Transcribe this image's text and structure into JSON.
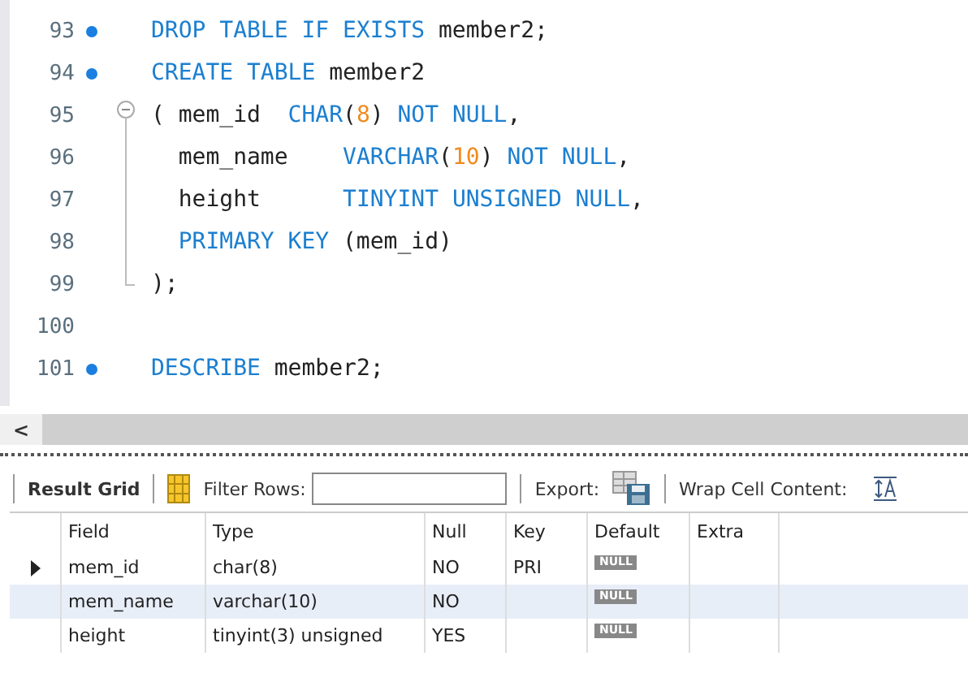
{
  "editor": {
    "lines": [
      {
        "number": "93",
        "statement": true,
        "fold_start": false,
        "fold_body": false,
        "fold_end": false,
        "tokens": [
          {
            "text": "DROP TABLE IF EXISTS",
            "kind": "keyword"
          },
          {
            "text": " member2;",
            "kind": "plain"
          }
        ]
      },
      {
        "number": "94",
        "statement": true,
        "fold_start": false,
        "fold_body": false,
        "fold_end": false,
        "tokens": [
          {
            "text": "CREATE TABLE",
            "kind": "keyword"
          },
          {
            "text": " member2",
            "kind": "plain"
          }
        ]
      },
      {
        "number": "95",
        "statement": false,
        "fold_start": true,
        "fold_body": false,
        "fold_end": false,
        "tokens": [
          {
            "text": "( mem_id  ",
            "kind": "plain"
          },
          {
            "text": "CHAR",
            "kind": "keyword"
          },
          {
            "text": "(",
            "kind": "plain"
          },
          {
            "text": "8",
            "kind": "number"
          },
          {
            "text": ") ",
            "kind": "plain"
          },
          {
            "text": "NOT NULL",
            "kind": "keyword"
          },
          {
            "text": ",",
            "kind": "plain"
          }
        ]
      },
      {
        "number": "96",
        "statement": false,
        "fold_start": false,
        "fold_body": true,
        "fold_end": false,
        "tokens": [
          {
            "text": "  mem_name    ",
            "kind": "plain"
          },
          {
            "text": "VARCHAR",
            "kind": "keyword"
          },
          {
            "text": "(",
            "kind": "plain"
          },
          {
            "text": "10",
            "kind": "number"
          },
          {
            "text": ") ",
            "kind": "plain"
          },
          {
            "text": "NOT NULL",
            "kind": "keyword"
          },
          {
            "text": ",",
            "kind": "plain"
          }
        ]
      },
      {
        "number": "97",
        "statement": false,
        "fold_start": false,
        "fold_body": true,
        "fold_end": false,
        "tokens": [
          {
            "text": "  height      ",
            "kind": "plain"
          },
          {
            "text": "TINYINT UNSIGNED NULL",
            "kind": "keyword"
          },
          {
            "text": ",",
            "kind": "plain"
          }
        ]
      },
      {
        "number": "98",
        "statement": false,
        "fold_start": false,
        "fold_body": true,
        "fold_end": false,
        "tokens": [
          {
            "text": "  PRIMARY KEY",
            "kind": "keyword"
          },
          {
            "text": " (mem_id)",
            "kind": "plain"
          }
        ]
      },
      {
        "number": "99",
        "statement": false,
        "fold_start": false,
        "fold_body": false,
        "fold_end": true,
        "tokens": [
          {
            "text": ");",
            "kind": "plain"
          }
        ]
      },
      {
        "number": "100",
        "statement": false,
        "fold_start": false,
        "fold_body": false,
        "fold_end": false
      },
      {
        "number": "101",
        "statement": true,
        "fold_start": false,
        "fold_body": false,
        "fold_end": false,
        "tokens": [
          {
            "text": "DESCRIBE",
            "kind": "keyword"
          },
          {
            "text": " member2;",
            "kind": "plain"
          }
        ]
      }
    ]
  },
  "scrollbar": {
    "arrow": "<"
  },
  "toolbar": {
    "result_grid": "Result Grid",
    "filter_label": "Filter Rows:",
    "export_label": "Export:",
    "wrap_label": "Wrap Cell Content:"
  },
  "grid": {
    "columns": [
      "Field",
      "Type",
      "Null",
      "Key",
      "Default",
      "Extra"
    ],
    "rows": [
      {
        "current": true,
        "cells": [
          "mem_id",
          "char(8)",
          "NO",
          "PRI",
          "NULL",
          null
        ]
      },
      {
        "current": false,
        "cells": [
          "mem_name",
          "varchar(10)",
          "NO",
          null,
          "NULL",
          null
        ]
      },
      {
        "current": false,
        "cells": [
          "height",
          "tinyint(3) unsigned",
          "YES",
          null,
          "NULL",
          null
        ]
      }
    ]
  }
}
